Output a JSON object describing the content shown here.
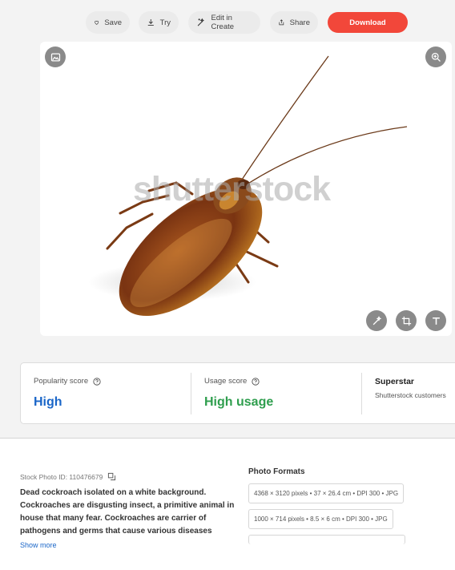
{
  "toolbar": {
    "save_label": "Save",
    "try_label": "Try",
    "edit_label": "Edit in Create",
    "share_label": "Share",
    "download_label": "Download",
    "accent_color": "#f2473a"
  },
  "image": {
    "watermark": "shutterstock",
    "subject": "cockroach",
    "icons": [
      "image-icon",
      "zoom-in-icon",
      "magic-wand-icon",
      "crop-icon",
      "text-icon"
    ]
  },
  "scores": {
    "popularity": {
      "label": "Popularity score",
      "value": "High",
      "color": "#1a66c8"
    },
    "usage": {
      "label": "Usage score",
      "value": "High usage",
      "color": "#2f9e4e"
    },
    "superstar": {
      "title": "Superstar",
      "subtitle": "Shutterstock customers"
    }
  },
  "details": {
    "stock_id": "Stock Photo ID: 110476679",
    "description": "Dead cockroach isolated on a white background. Cockroaches are disgusting insect, a primitive animal in house that many fear. Cockroaches are carrier of pathogens and germs that cause various diseases",
    "show_more": "Show more"
  },
  "formats": {
    "title": "Photo Formats",
    "items": [
      "4368 × 3120 pixels • 37 × 26.4 cm • DPI 300 • JPG",
      "1000 × 714 pixels • 8.5 × 6 cm • DPI 300 • JPG"
    ]
  }
}
